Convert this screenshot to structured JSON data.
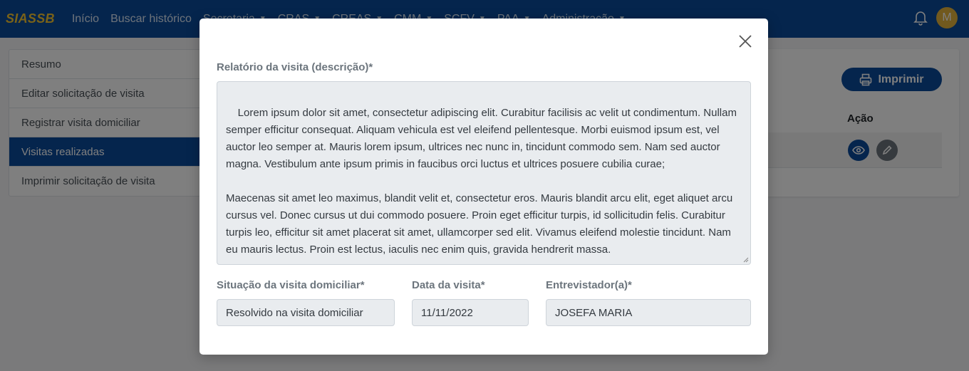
{
  "navbar": {
    "brand": "SIASSB",
    "items": [
      "Início",
      "Buscar histórico",
      "Secretaria",
      "CRAS",
      "CREAS",
      "CMM",
      "SCFV",
      "PAA",
      "Administração"
    ],
    "dropdown_items": [
      false,
      false,
      true,
      true,
      true,
      true,
      true,
      true,
      true
    ],
    "avatar_initial": "M",
    "caret": "▼"
  },
  "side_menu": {
    "items": [
      "Resumo",
      "Editar solicitação de visita",
      "Registrar visita domiciliar",
      "Visitas realizadas",
      "Imprimir solicitação de visita"
    ],
    "active_index": 3
  },
  "main": {
    "print_label": "Imprimir",
    "action_header": "Ação"
  },
  "modal": {
    "description_label": "Relatório da visita (descrição)*",
    "description_text": "Lorem ipsum dolor sit amet, consectetur adipiscing elit. Curabitur facilisis ac velit ut condimentum. Nullam semper efficitur consequat. Aliquam vehicula est vel eleifend pellentesque. Morbi euismod ipsum est, vel auctor leo semper at. Mauris lorem ipsum, ultrices nec nunc in, tincidunt commodo sem. Nam sed auctor magna. Vestibulum ante ipsum primis in faucibus orci luctus et ultrices posuere cubilia curae;\n\nMaecenas sit amet leo maximus, blandit velit et, consectetur eros. Mauris blandit arcu elit, eget aliquet arcu cursus vel. Donec cursus ut dui commodo posuere. Proin eget efficitur turpis, id sollicitudin felis. Curabitur turpis leo, efficitur sit amet placerat sit amet, ullamcorper sed elit. Vivamus eleifend molestie tincidunt. Nam eu mauris lectus. Proin est lectus, iaculis nec enim quis, gravida hendrerit massa.",
    "situacao_label": "Situação da visita domiciliar*",
    "situacao_value": "Resolvido na visita domiciliar",
    "data_label": "Data da visita*",
    "data_value": "11/11/2022",
    "entrevistador_label": "Entrevistador(a)*",
    "entrevistador_value": "JOSEFA MARIA"
  },
  "colors": {
    "primary": "#0b4a9a",
    "brand_yellow": "#f4c430",
    "avatar": "#e3b23c"
  },
  "icons": [
    "bell-icon",
    "printer-icon",
    "eye-icon",
    "pencil-icon",
    "close-icon"
  ]
}
